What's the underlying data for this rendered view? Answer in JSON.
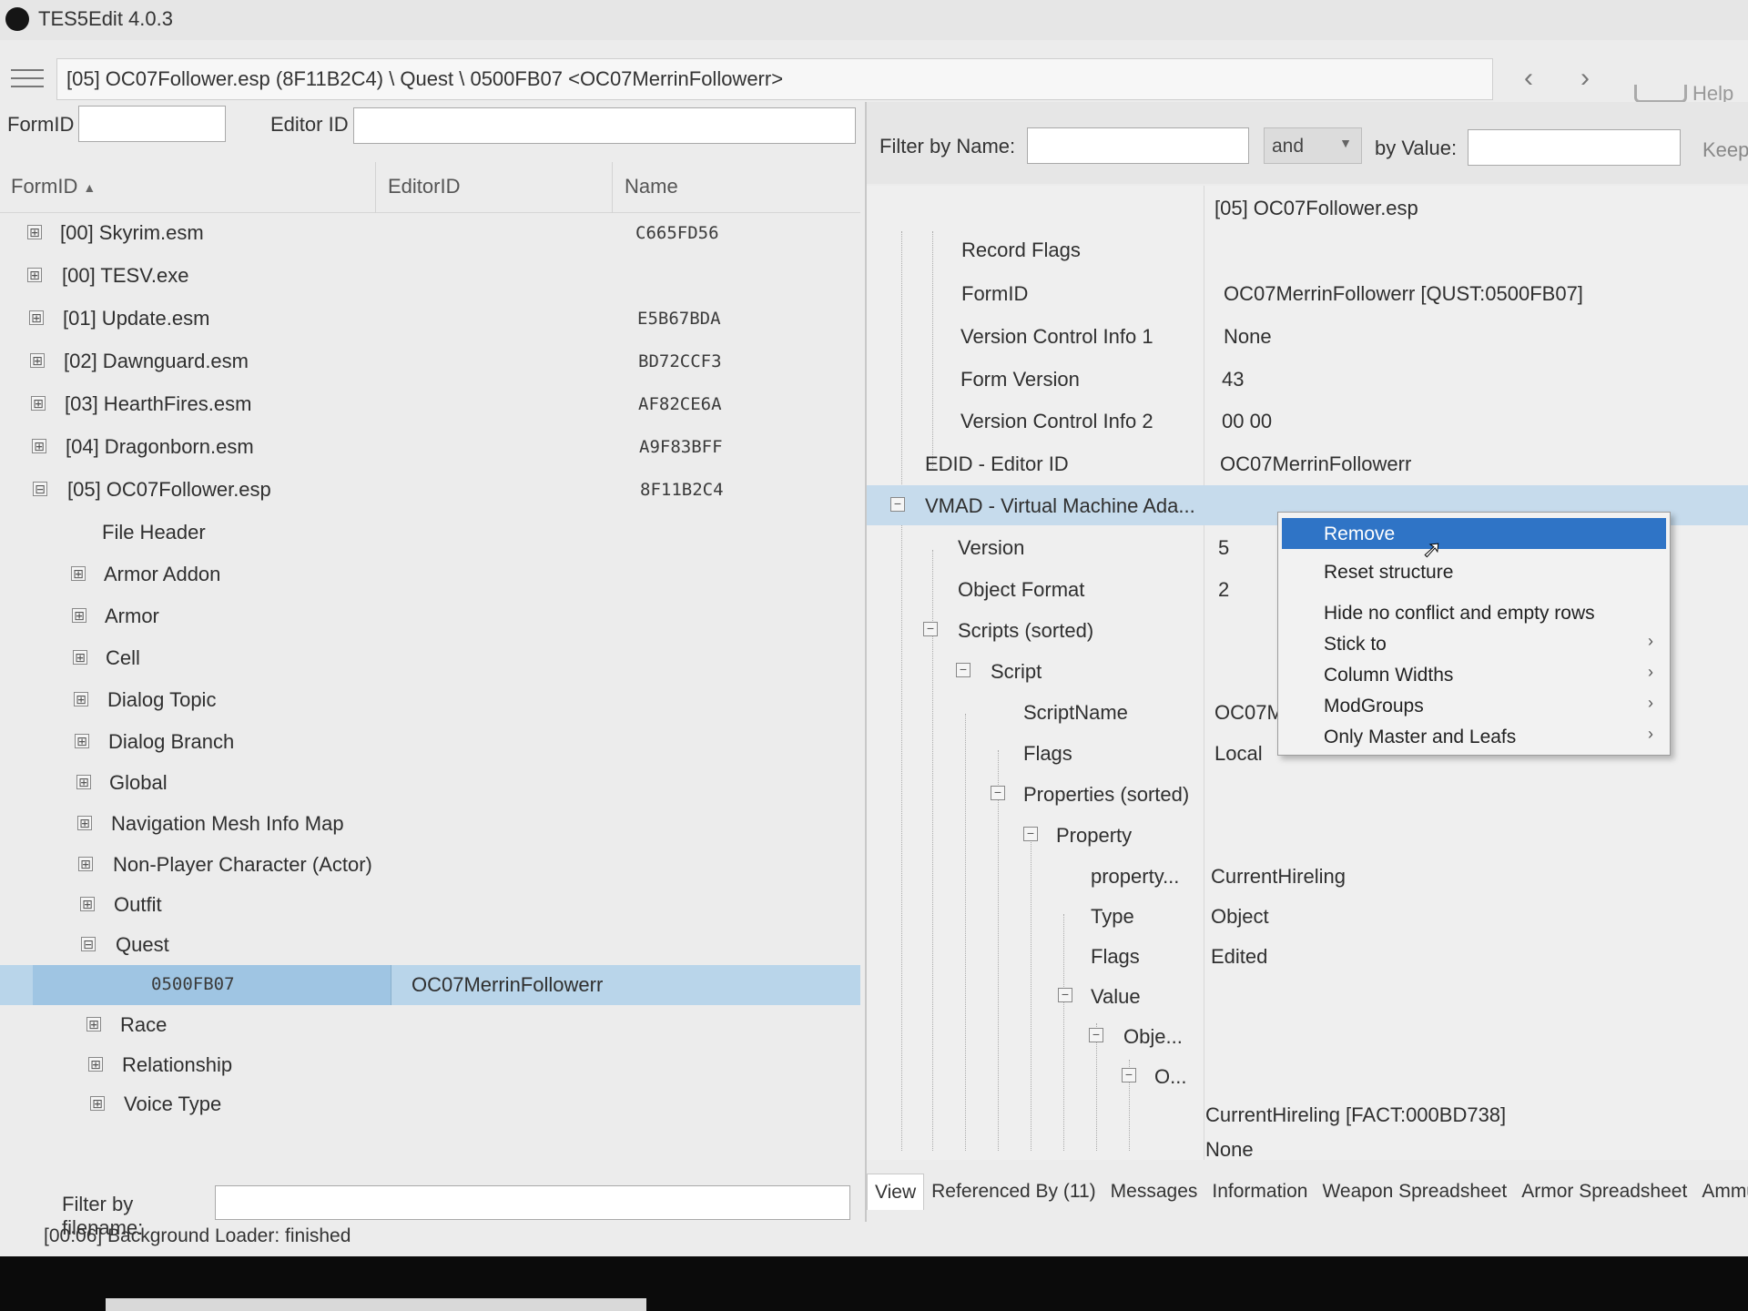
{
  "window": {
    "title": "TES5Edit 4.0.3"
  },
  "toolbar": {
    "path": "[05] OC07Follower.esp (8F11B2C4) \\ Quest \\ 0500FB07 <OC07MerrinFollowerr>",
    "back": "‹",
    "forward": "›",
    "help_label": "Help"
  },
  "left": {
    "formid_label": "FormID",
    "editorid_label": "Editor ID",
    "columns": {
      "formid": "FormID",
      "editorid": "EditorID",
      "name": "Name"
    },
    "tree": [
      {
        "label": "[00] Skyrim.esm",
        "name": "C665FD56",
        "expander": "⊞"
      },
      {
        "label": "[00] TESV.exe",
        "name": "",
        "expander": "⊞"
      },
      {
        "label": "[01] Update.esm",
        "name": "E5B67BDA",
        "expander": "⊞"
      },
      {
        "label": "[02] Dawnguard.esm",
        "name": "BD72CCF3",
        "expander": "⊞"
      },
      {
        "label": "[03] HearthFires.esm",
        "name": "AF82CE6A",
        "expander": "⊞"
      },
      {
        "label": "[04] Dragonborn.esm",
        "name": "A9F83BFF",
        "expander": "⊞"
      },
      {
        "label": "[05] OC07Follower.esp",
        "name": "8F11B2C4",
        "expander": "⊟"
      },
      {
        "label": "File Header",
        "name": "",
        "expander": ""
      },
      {
        "label": "Armor Addon",
        "name": "",
        "expander": "⊞"
      },
      {
        "label": "Armor",
        "name": "",
        "expander": "⊞"
      },
      {
        "label": "Cell",
        "name": "",
        "expander": "⊞"
      },
      {
        "label": "Dialog Topic",
        "name": "",
        "expander": "⊞"
      },
      {
        "label": "Dialog Branch",
        "name": "",
        "expander": "⊞"
      },
      {
        "label": "Global",
        "name": "",
        "expander": "⊞"
      },
      {
        "label": "Navigation Mesh Info Map",
        "name": "",
        "expander": "⊞"
      },
      {
        "label": "Non-Player Character (Actor)",
        "name": "",
        "expander": "⊞"
      },
      {
        "label": "Outfit",
        "name": "",
        "expander": "⊞"
      },
      {
        "label": "Quest",
        "name": "",
        "expander": "⊟"
      },
      {
        "label": "0500FB07",
        "editorid": "OC07MerrinFollowerr",
        "selected": true
      },
      {
        "label": "Race",
        "name": "",
        "expander": "⊞"
      },
      {
        "label": "Relationship",
        "name": "",
        "expander": "⊞"
      },
      {
        "label": "Voice Type",
        "name": "",
        "expander": "⊞"
      }
    ],
    "filter_label": "Filter by filename:"
  },
  "status": "[00:06] Background Loader: finished",
  "right": {
    "filter_name_label": "Filter by Name:",
    "and_option": "and",
    "by_value_label": "by Value:",
    "keep_label": "Keep",
    "rows": [
      {
        "label": "",
        "value": "[05] OC07Follower.esp"
      },
      {
        "label": "Record Flags",
        "value": ""
      },
      {
        "label": "FormID",
        "value": "OC07MerrinFollowerr [QUST:0500FB07]"
      },
      {
        "label": "Version Control Info 1",
        "value": "None"
      },
      {
        "label": "Form Version",
        "value": "43"
      },
      {
        "label": "Version Control Info 2",
        "value": "00 00"
      },
      {
        "label": "EDID - Editor ID",
        "value": "OC07MerrinFollowerr"
      },
      {
        "label": "VMAD - Virtual Machine Ada...",
        "value": ""
      },
      {
        "label": "Version",
        "value": "5"
      },
      {
        "label": "Object Format",
        "value": "2"
      },
      {
        "label": "Scripts (sorted)",
        "value": ""
      },
      {
        "label": "Script",
        "value": ""
      },
      {
        "label": "ScriptName",
        "value": "OC07M"
      },
      {
        "label": "Flags",
        "value": "Local"
      },
      {
        "label": "Properties (sorted)",
        "value": ""
      },
      {
        "label": "Property",
        "value": ""
      },
      {
        "label": "property...",
        "value": "CurrentHireling"
      },
      {
        "label": "Type",
        "value": "Object"
      },
      {
        "label": "Flags",
        "value": "Edited"
      },
      {
        "label": "Value",
        "value": ""
      },
      {
        "label": "Obje...",
        "value": ""
      },
      {
        "label": "O...",
        "value": ""
      },
      {
        "label": "",
        "value": "CurrentHireling [FACT:000BD738]"
      },
      {
        "label": "",
        "value": "None"
      }
    ],
    "tabs": [
      "View",
      "Referenced By (11)",
      "Messages",
      "Information",
      "Weapon Spreadsheet",
      "Armor Spreadsheet",
      "Ammun"
    ]
  },
  "context_menu": {
    "items": [
      {
        "label": "Remove",
        "arrow": ""
      },
      {
        "label": "Reset structure",
        "arrow": ""
      },
      {
        "label": "Hide no conflict and empty rows",
        "arrow": ""
      },
      {
        "label": "Stick to",
        "arrow": "›"
      },
      {
        "label": "Column Widths",
        "arrow": "›"
      },
      {
        "label": "ModGroups",
        "arrow": "›"
      },
      {
        "label": "Only Master and Leafs",
        "arrow": "›"
      }
    ]
  },
  "colors": {
    "selection": "#b9d5ea",
    "menu_highlight": "#2f74c6",
    "grid_highlight": "#c6dbec"
  }
}
